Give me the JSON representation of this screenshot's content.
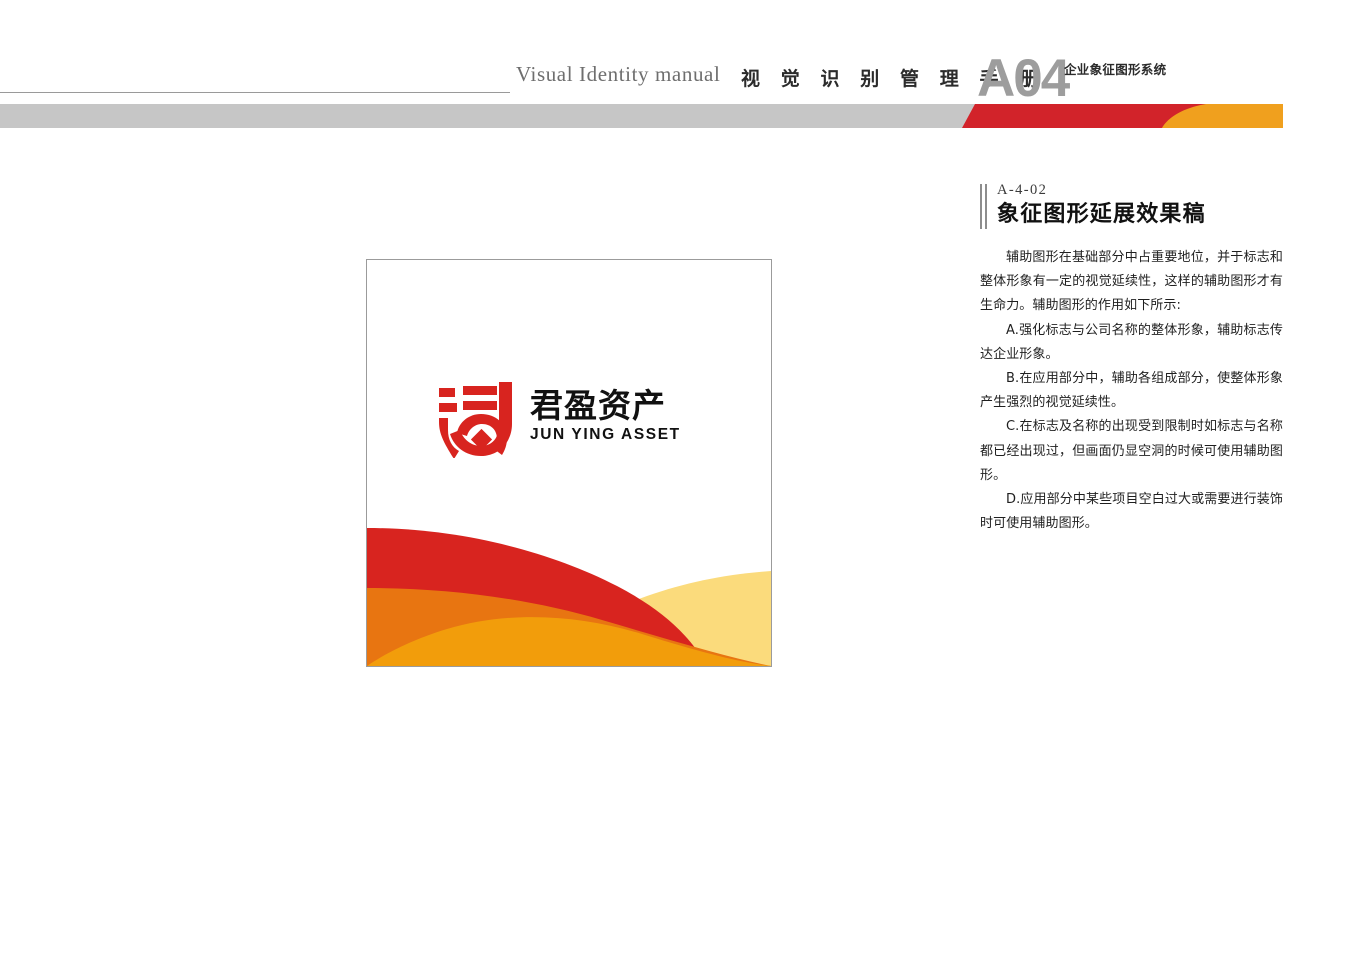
{
  "header": {
    "title_en": "Visual Identity  manual",
    "title_cn": "视 觉 识 别 管 理 手 册",
    "code": "A04",
    "code_subtitle": "企业象征图形系统",
    "band_colors": {
      "gray": "#c6c6c6",
      "red": "#d2232a",
      "orange": "#f0a01e"
    }
  },
  "info_panel": {
    "code": "A-4-02",
    "title": "象征图形延展效果稿",
    "paragraphs": [
      "辅助图形在基础部分中占重要地位，并于标志和整体形象有一定的视觉延续性，这样的辅助图形才有生命力。辅助图形的作用如下所示:",
      "A.强化标志与公司名称的整体形象，辅助标志传达企业形象。",
      "B.在应用部分中，辅助各组成部分，使整体形象产生强烈的视觉延续性。",
      "C.在标志及名称的出现受到限制时如标志与名称都已经出现过，但画面仍显空洞的时候可使用辅助图形。",
      "D.应用部分中某些项目空白过大或需要进行装饰时可使用辅助图形。"
    ]
  },
  "sample_card": {
    "logo": {
      "name_cn": "君盈资产",
      "name_en": "JUN YING ASSET",
      "mark_color": "#d8241f",
      "text_color": "#111111"
    },
    "wave_colors": {
      "red": "#d8241f",
      "orange_dark": "#e87511",
      "orange": "#f29d0b",
      "yellow": "#fbdb7c"
    },
    "border_color": "#9b9b9b"
  }
}
